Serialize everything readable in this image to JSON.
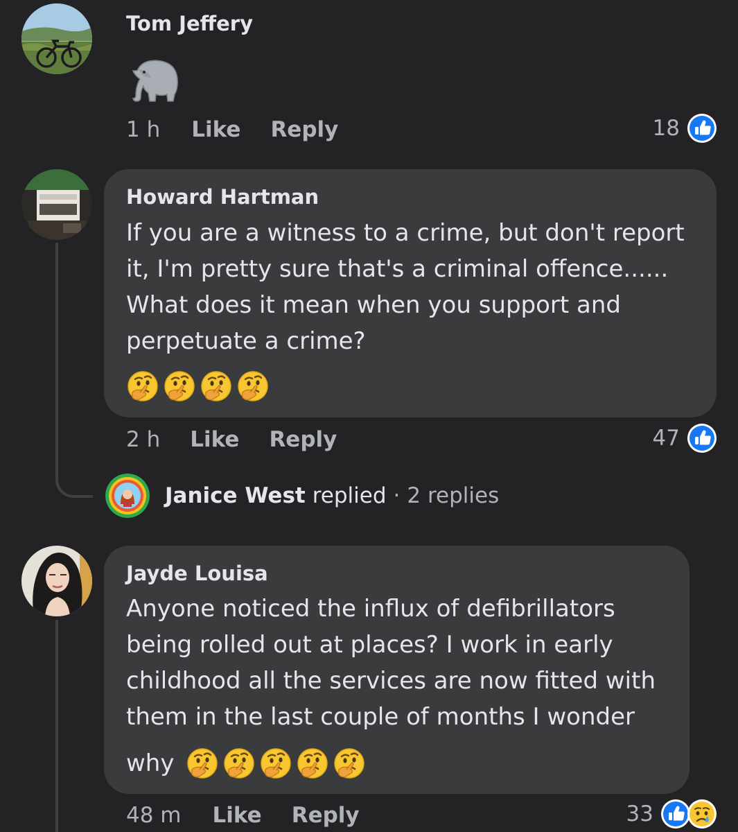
{
  "comments": [
    {
      "author": "Tom Jeffery",
      "body_emoji": "elephant",
      "time": "1 h",
      "like_label": "Like",
      "reply_label": "Reply",
      "reaction_count": "18",
      "reactions": [
        "like-icon"
      ]
    },
    {
      "author": "Howard Hartman",
      "lines": [
        "If you are a witness to a crime, but don't report",
        "it, I'm pretty sure that's a criminal offence......",
        "What does it mean when you support and",
        "perpetuate a crime?"
      ],
      "emoji_line": [
        "thinking-face",
        "thinking-face",
        "thinking-face",
        "thinking-face"
      ],
      "time": "2 h",
      "like_label": "Like",
      "reply_label": "Reply",
      "reaction_count": "47",
      "reactions": [
        "like-icon"
      ],
      "replies": {
        "replier": "Janice West",
        "replied_label": "replied",
        "separator": "·",
        "count_label": "2 replies"
      }
    },
    {
      "author": "Jayde Louisa",
      "lines": [
        "Anyone noticed the influx of defibrillators",
        "being rolled out at places? I work in early",
        "childhood all the services are now fitted with",
        "them in the last couple of months I wonder"
      ],
      "last_line_text": "why",
      "emoji_line": [
        "thinking-face",
        "thinking-face",
        "thinking-face",
        "thinking-face",
        "thinking-face"
      ],
      "time": "48 m",
      "like_label": "Like",
      "reply_label": "Reply",
      "reaction_count": "33",
      "reactions": [
        "like-icon",
        "sad-icon"
      ]
    }
  ],
  "colors": {
    "background": "#232325",
    "bubble": "#3a3b3c",
    "text_primary": "#e4e6eb",
    "text_secondary": "#b0b3b8",
    "like_blue": "#1877f2",
    "thread_line": "#3e4042"
  }
}
